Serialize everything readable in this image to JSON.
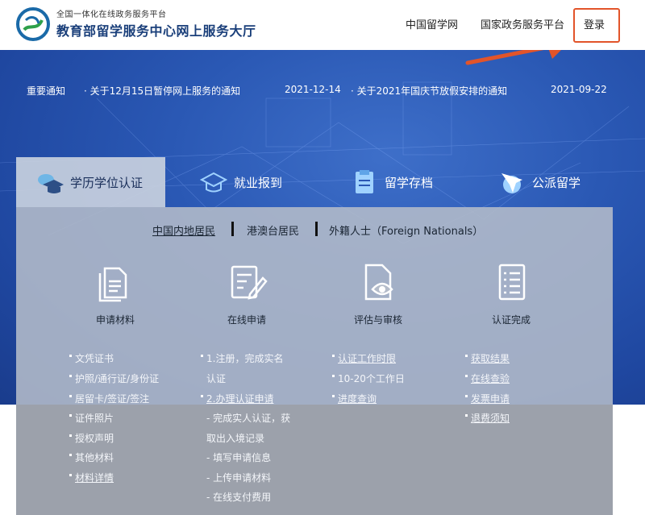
{
  "header": {
    "logo_subtitle": "全国一体化在线政务服务平台",
    "logo_title": "教育部留学服务中心网上服务大厅",
    "nav": [
      "中国留学网",
      "国家政务服务平台"
    ],
    "login_label": "登录"
  },
  "notices": {
    "label": "重要通知",
    "items": [
      {
        "title": "关于12月15日暂停网上服务的通知",
        "date": "2021-12-14"
      },
      {
        "title": "关于2021年国庆节放假安排的通知",
        "date": "2021-09-22"
      }
    ]
  },
  "tabs": [
    {
      "label": "学历学位认证",
      "icon": "graduation-cap-icon",
      "active": true
    },
    {
      "label": "就业报到",
      "icon": "mortarboard-icon",
      "active": false
    },
    {
      "label": "留学存档",
      "icon": "archive-icon",
      "active": false
    },
    {
      "label": "公派留学",
      "icon": "airplane-globe-icon",
      "active": false
    }
  ],
  "residents": [
    "中国内地居民",
    "港澳台居民",
    "外籍人士（Foreign Nationals）"
  ],
  "steps": [
    {
      "label": "申请材料",
      "icon": "documents-icon"
    },
    {
      "label": "在线申请",
      "icon": "form-pen-icon"
    },
    {
      "label": "评估与审核",
      "icon": "document-eye-icon"
    },
    {
      "label": "认证完成",
      "icon": "checklist-icon"
    }
  ],
  "materials": [
    "文凭证书",
    "护照/通行证/身份证",
    "居留卡/签证/签注",
    "证件照片",
    "授权声明",
    "其他材料",
    "材料详情"
  ],
  "online_apply": [
    "1.注册，完成实名",
    "认证",
    "2.办理认证申请",
    "- 完成实人认证，获",
    "取出入境记录",
    "- 填写申请信息",
    "- 上传申请材料",
    "- 在线支付费用"
  ],
  "review": [
    "认证工作时限",
    "10-20个工作日",
    "进度查询"
  ],
  "complete": [
    "获取结果",
    "在线查验",
    "发票申请",
    "退费须知"
  ],
  "colors": {
    "brand_blue": "#1a3f7a",
    "highlight_red": "#e2542a",
    "hero_blue": "#2a58b4"
  }
}
